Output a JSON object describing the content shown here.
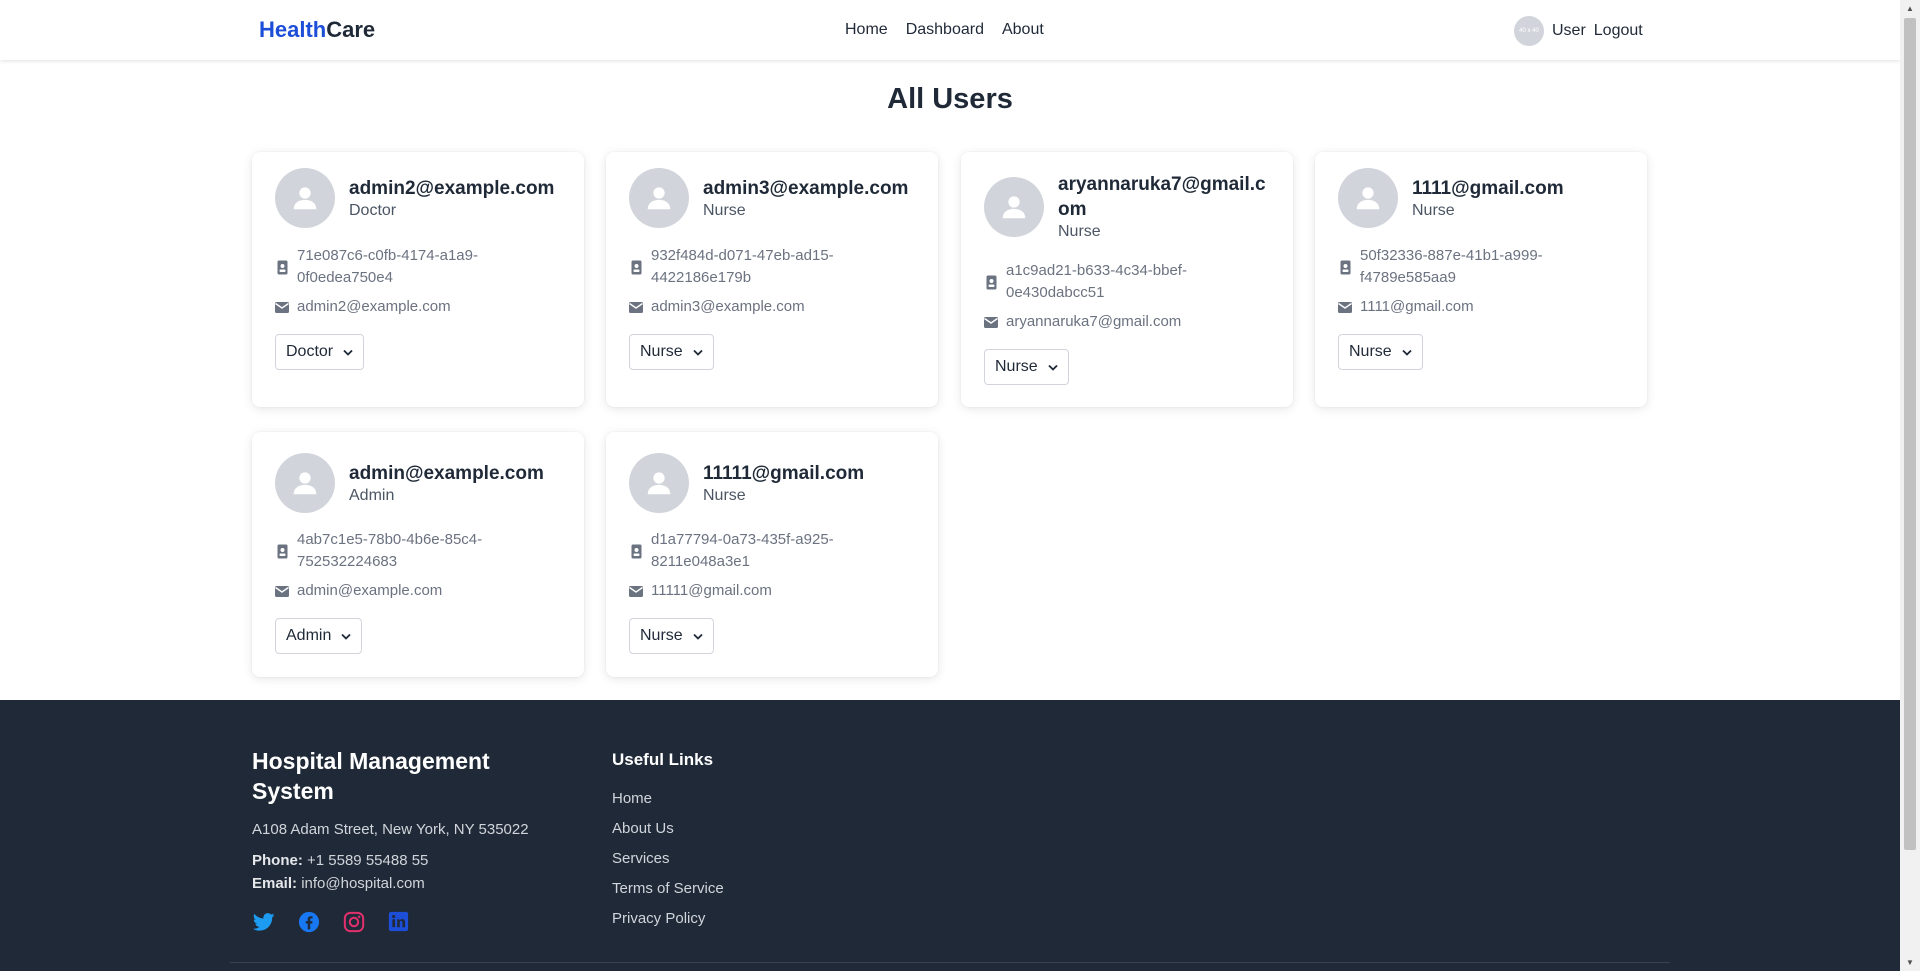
{
  "nav": {
    "brand_part1": "Health",
    "brand_part2": "Care",
    "links": [
      "Home",
      "Dashboard",
      "About"
    ],
    "avatar_text": "40 x 40",
    "user": "User",
    "logout": "Logout"
  },
  "page_title": "All Users",
  "users": [
    {
      "email": "admin2@example.com",
      "role": "Doctor",
      "id": "71e087c6-c0fb-4174-a1a9-0f0edea750e4",
      "contact": "admin2@example.com",
      "selected_role": "Doctor"
    },
    {
      "email": "admin3@example.com",
      "role": "Nurse",
      "id": "932f484d-d071-47eb-ad15-4422186e179b",
      "contact": "admin3@example.com",
      "selected_role": "Nurse"
    },
    {
      "email": "aryannaruka7@gmail.com",
      "role": "Nurse",
      "id": "a1c9ad21-b633-4c34-bbef-0e430dabcc51",
      "contact": "aryannaruka7@gmail.com",
      "selected_role": "Nurse"
    },
    {
      "email": "1111@gmail.com",
      "role": "Nurse",
      "id": "50f32336-887e-41b1-a999-f4789e585aa9",
      "contact": "1111@gmail.com",
      "selected_role": "Nurse"
    },
    {
      "email": "admin@example.com",
      "role": "Admin",
      "id": "4ab7c1e5-78b0-4b6e-85c4-752532224683",
      "contact": "admin@example.com",
      "selected_role": "Admin"
    },
    {
      "email": "11111@gmail.com",
      "role": "Nurse",
      "id": "d1a77794-0a73-435f-a925-8211e048a3e1",
      "contact": "11111@gmail.com",
      "selected_role": "Nurse"
    }
  ],
  "footer": {
    "title": "Hospital Management System",
    "address": "A108 Adam Street, New York, NY 535022",
    "phone_label": "Phone:",
    "phone": "+1 5589 55488 55",
    "email_label": "Email:",
    "email": "info@hospital.com",
    "links_title": "Useful Links",
    "links": [
      "Home",
      "About Us",
      "Services",
      "Terms of Service",
      "Privacy Policy"
    ],
    "socials": [
      "twitter-icon",
      "facebook-icon",
      "instagram-icon",
      "linkedin-icon"
    ]
  },
  "colors": {
    "brand_blue": "#1d4ed8",
    "footer_bg": "#1f2937",
    "twitter": "#1d9bf0",
    "facebook": "#1877f2",
    "instagram": "#e1306c",
    "linkedin": "#1d4ed8"
  }
}
